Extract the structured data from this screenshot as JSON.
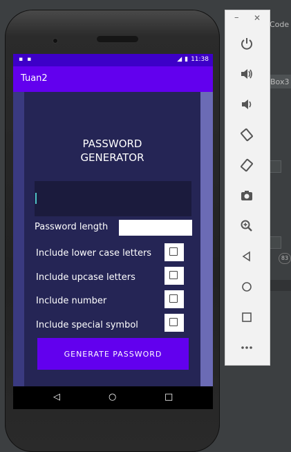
{
  "ide": {
    "code_label": "Code",
    "box_label": "Box3",
    "badge": "83"
  },
  "status_bar": {
    "left_icons": [
      "sim-card-icon",
      "android-icon"
    ],
    "right_icons": [
      "signal-icon",
      "battery-icon"
    ],
    "time": "11:38"
  },
  "app_bar": {
    "title": "Tuan2"
  },
  "generator": {
    "heading_line1": "PASSWORD",
    "heading_line2": "GENERATOR",
    "password_value": "",
    "length_label": "Password length",
    "length_value": "",
    "options": [
      {
        "label": "Include lower case letters",
        "checked": false
      },
      {
        "label": "Include upcase letters",
        "checked": false
      },
      {
        "label": "Include number",
        "checked": false
      },
      {
        "label": "Include special symbol",
        "checked": false
      }
    ],
    "button_label": "GENERATE PASSWORD"
  },
  "nav_bar": {
    "back_glyph": "◁",
    "home_glyph": "○",
    "recents_glyph": "□"
  },
  "emulator_panel": {
    "minimize_glyph": "–",
    "close_glyph": "✕",
    "buttons": [
      {
        "name": "power-icon",
        "glyph": "⏻"
      },
      {
        "name": "volume-up-icon",
        "glyph": "🔊"
      },
      {
        "name": "volume-down-icon",
        "glyph": "🔉"
      },
      {
        "name": "rotate-left-icon",
        "glyph": "⟲"
      },
      {
        "name": "rotate-right-icon",
        "glyph": "⟳"
      },
      {
        "name": "camera-icon",
        "glyph": "📷"
      },
      {
        "name": "zoom-icon",
        "glyph": "⊕"
      },
      {
        "name": "back-icon",
        "glyph": "◁"
      },
      {
        "name": "home-icon",
        "glyph": "○"
      },
      {
        "name": "overview-icon",
        "glyph": "□"
      },
      {
        "name": "more-icon",
        "glyph": "•••"
      }
    ]
  },
  "colors": {
    "primary": "#6200ee",
    "primary_dark": "#3d00c8",
    "content_bg": "#252555"
  }
}
